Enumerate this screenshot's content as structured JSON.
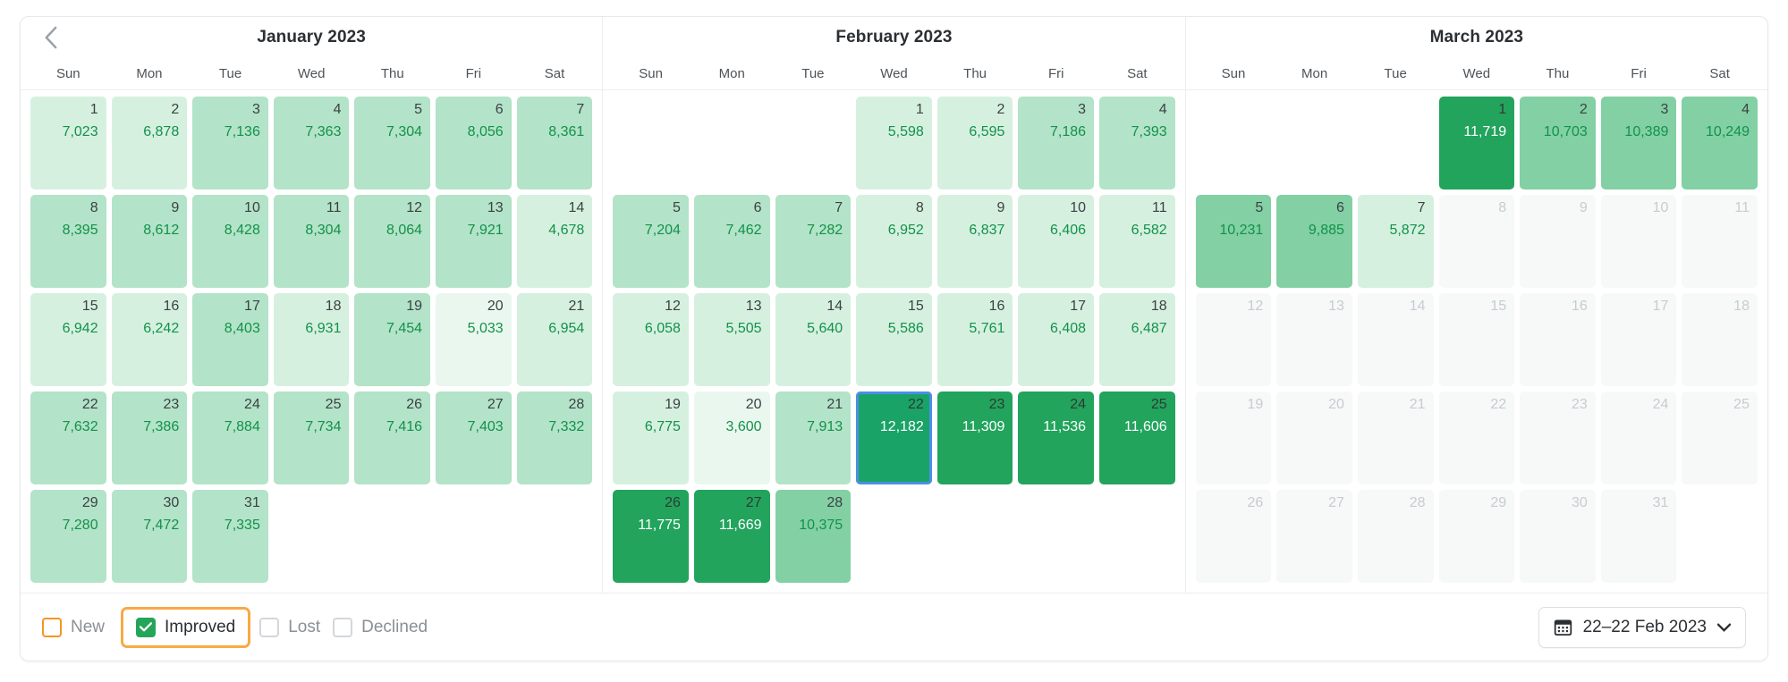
{
  "colors": {
    "value_green": "#12924a",
    "selected_outline": "#4a90e2",
    "highlight_orange": "#f8a945",
    "checkbox_green": "#23a55a",
    "disabled_cell": "#f7f8f8",
    "disabled_text": "#c7ccd1"
  },
  "nav": {
    "prev_label": "Previous months",
    "prev_icon": "chevron-left-icon"
  },
  "day_names": [
    "Sun",
    "Mon",
    "Tue",
    "Wed",
    "Thu",
    "Fri",
    "Sat"
  ],
  "months": [
    {
      "title": "January 2023",
      "weeks": [
        [
          {
            "day": "1",
            "value": "7,023",
            "level": 2
          },
          {
            "day": "2",
            "value": "6,878",
            "level": 2
          },
          {
            "day": "3",
            "value": "7,136",
            "level": 3
          },
          {
            "day": "4",
            "value": "7,363",
            "level": 3
          },
          {
            "day": "5",
            "value": "7,304",
            "level": 3
          },
          {
            "day": "6",
            "value": "8,056",
            "level": 3
          },
          {
            "day": "7",
            "value": "8,361",
            "level": 3
          }
        ],
        [
          {
            "day": "8",
            "value": "8,395",
            "level": 3
          },
          {
            "day": "9",
            "value": "8,612",
            "level": 3
          },
          {
            "day": "10",
            "value": "8,428",
            "level": 3
          },
          {
            "day": "11",
            "value": "8,304",
            "level": 3
          },
          {
            "day": "12",
            "value": "8,064",
            "level": 3
          },
          {
            "day": "13",
            "value": "7,921",
            "level": 3
          },
          {
            "day": "14",
            "value": "4,678",
            "level": 2
          }
        ],
        [
          {
            "day": "15",
            "value": "6,942",
            "level": 2
          },
          {
            "day": "16",
            "value": "6,242",
            "level": 2
          },
          {
            "day": "17",
            "value": "8,403",
            "level": 3
          },
          {
            "day": "18",
            "value": "6,931",
            "level": 2
          },
          {
            "day": "19",
            "value": "7,454",
            "level": 3
          },
          {
            "day": "20",
            "value": "5,033",
            "level": 1
          },
          {
            "day": "21",
            "value": "6,954",
            "level": 2
          }
        ],
        [
          {
            "day": "22",
            "value": "7,632",
            "level": 3
          },
          {
            "day": "23",
            "value": "7,386",
            "level": 3
          },
          {
            "day": "24",
            "value": "7,884",
            "level": 3
          },
          {
            "day": "25",
            "value": "7,734",
            "level": 3
          },
          {
            "day": "26",
            "value": "7,416",
            "level": 3
          },
          {
            "day": "27",
            "value": "7,403",
            "level": 3
          },
          {
            "day": "28",
            "value": "7,332",
            "level": 3
          }
        ],
        [
          {
            "day": "29",
            "value": "7,280",
            "level": 3
          },
          {
            "day": "30",
            "value": "7,472",
            "level": 3
          },
          {
            "day": "31",
            "value": "7,335",
            "level": 3
          },
          {
            "empty": true
          },
          {
            "empty": true
          },
          {
            "empty": true
          },
          {
            "empty": true
          }
        ]
      ]
    },
    {
      "title": "February 2023",
      "weeks": [
        [
          {
            "empty": true
          },
          {
            "empty": true
          },
          {
            "empty": true
          },
          {
            "day": "1",
            "value": "5,598",
            "level": 2
          },
          {
            "day": "2",
            "value": "6,595",
            "level": 2
          },
          {
            "day": "3",
            "value": "7,186",
            "level": 3
          },
          {
            "day": "4",
            "value": "7,393",
            "level": 3
          }
        ],
        [
          {
            "day": "5",
            "value": "7,204",
            "level": 3
          },
          {
            "day": "6",
            "value": "7,462",
            "level": 3
          },
          {
            "day": "7",
            "value": "7,282",
            "level": 3
          },
          {
            "day": "8",
            "value": "6,952",
            "level": 2
          },
          {
            "day": "9",
            "value": "6,837",
            "level": 2
          },
          {
            "day": "10",
            "value": "6,406",
            "level": 2
          },
          {
            "day": "11",
            "value": "6,582",
            "level": 2
          }
        ],
        [
          {
            "day": "12",
            "value": "6,058",
            "level": 2
          },
          {
            "day": "13",
            "value": "5,505",
            "level": 2
          },
          {
            "day": "14",
            "value": "5,640",
            "level": 2
          },
          {
            "day": "15",
            "value": "5,586",
            "level": 2
          },
          {
            "day": "16",
            "value": "5,761",
            "level": 2
          },
          {
            "day": "17",
            "value": "6,408",
            "level": 2
          },
          {
            "day": "18",
            "value": "6,487",
            "level": 2
          }
        ],
        [
          {
            "day": "19",
            "value": "6,775",
            "level": 2
          },
          {
            "day": "20",
            "value": "3,600",
            "level": 1
          },
          {
            "day": "21",
            "value": "7,913",
            "level": 3
          },
          {
            "day": "22",
            "value": "12,182",
            "level": 5,
            "selected": true
          },
          {
            "day": "23",
            "value": "11,309",
            "level": 5
          },
          {
            "day": "24",
            "value": "11,536",
            "level": 5
          },
          {
            "day": "25",
            "value": "11,606",
            "level": 5
          }
        ],
        [
          {
            "day": "26",
            "value": "11,775",
            "level": 5
          },
          {
            "day": "27",
            "value": "11,669",
            "level": 5
          },
          {
            "day": "28",
            "value": "10,375",
            "level": 4
          },
          {
            "empty": true
          },
          {
            "empty": true
          },
          {
            "empty": true
          },
          {
            "empty": true
          }
        ]
      ]
    },
    {
      "title": "March 2023",
      "weeks": [
        [
          {
            "empty": true
          },
          {
            "empty": true
          },
          {
            "empty": true
          },
          {
            "day": "1",
            "value": "11,719",
            "level": 5
          },
          {
            "day": "2",
            "value": "10,703",
            "level": 4
          },
          {
            "day": "3",
            "value": "10,389",
            "level": 4
          },
          {
            "day": "4",
            "value": "10,249",
            "level": 4
          }
        ],
        [
          {
            "day": "5",
            "value": "10,231",
            "level": 4
          },
          {
            "day": "6",
            "value": "9,885",
            "level": 4
          },
          {
            "day": "7",
            "value": "5,872",
            "level": 2
          },
          {
            "day": "8",
            "disabled": true
          },
          {
            "day": "9",
            "disabled": true
          },
          {
            "day": "10",
            "disabled": true
          },
          {
            "day": "11",
            "disabled": true
          }
        ],
        [
          {
            "day": "12",
            "disabled": true
          },
          {
            "day": "13",
            "disabled": true
          },
          {
            "day": "14",
            "disabled": true
          },
          {
            "day": "15",
            "disabled": true
          },
          {
            "day": "16",
            "disabled": true
          },
          {
            "day": "17",
            "disabled": true
          },
          {
            "day": "18",
            "disabled": true
          }
        ],
        [
          {
            "day": "19",
            "disabled": true
          },
          {
            "day": "20",
            "disabled": true
          },
          {
            "day": "21",
            "disabled": true
          },
          {
            "day": "22",
            "disabled": true
          },
          {
            "day": "23",
            "disabled": true
          },
          {
            "day": "24",
            "disabled": true
          },
          {
            "day": "25",
            "disabled": true
          }
        ],
        [
          {
            "day": "26",
            "disabled": true
          },
          {
            "day": "27",
            "disabled": true
          },
          {
            "day": "28",
            "disabled": true
          },
          {
            "day": "29",
            "disabled": true
          },
          {
            "day": "30",
            "disabled": true
          },
          {
            "day": "31",
            "disabled": true
          },
          {
            "empty": true
          }
        ]
      ]
    }
  ],
  "footer": {
    "legend": [
      {
        "label": "New",
        "checked": false,
        "style": "orange-box",
        "icon": "checkbox-icon"
      },
      {
        "label": "Improved",
        "checked": true,
        "style": "highlighted",
        "icon": "checkbox-checked-icon"
      },
      {
        "label": "Lost",
        "checked": false,
        "style": "default",
        "icon": "checkbox-icon"
      },
      {
        "label": "Declined",
        "checked": false,
        "style": "default",
        "icon": "checkbox-icon"
      }
    ],
    "date_picker": {
      "value": "22–22 Feb 2023",
      "calendar_icon": "calendar-icon",
      "chevron_icon": "chevron-down-icon"
    }
  }
}
